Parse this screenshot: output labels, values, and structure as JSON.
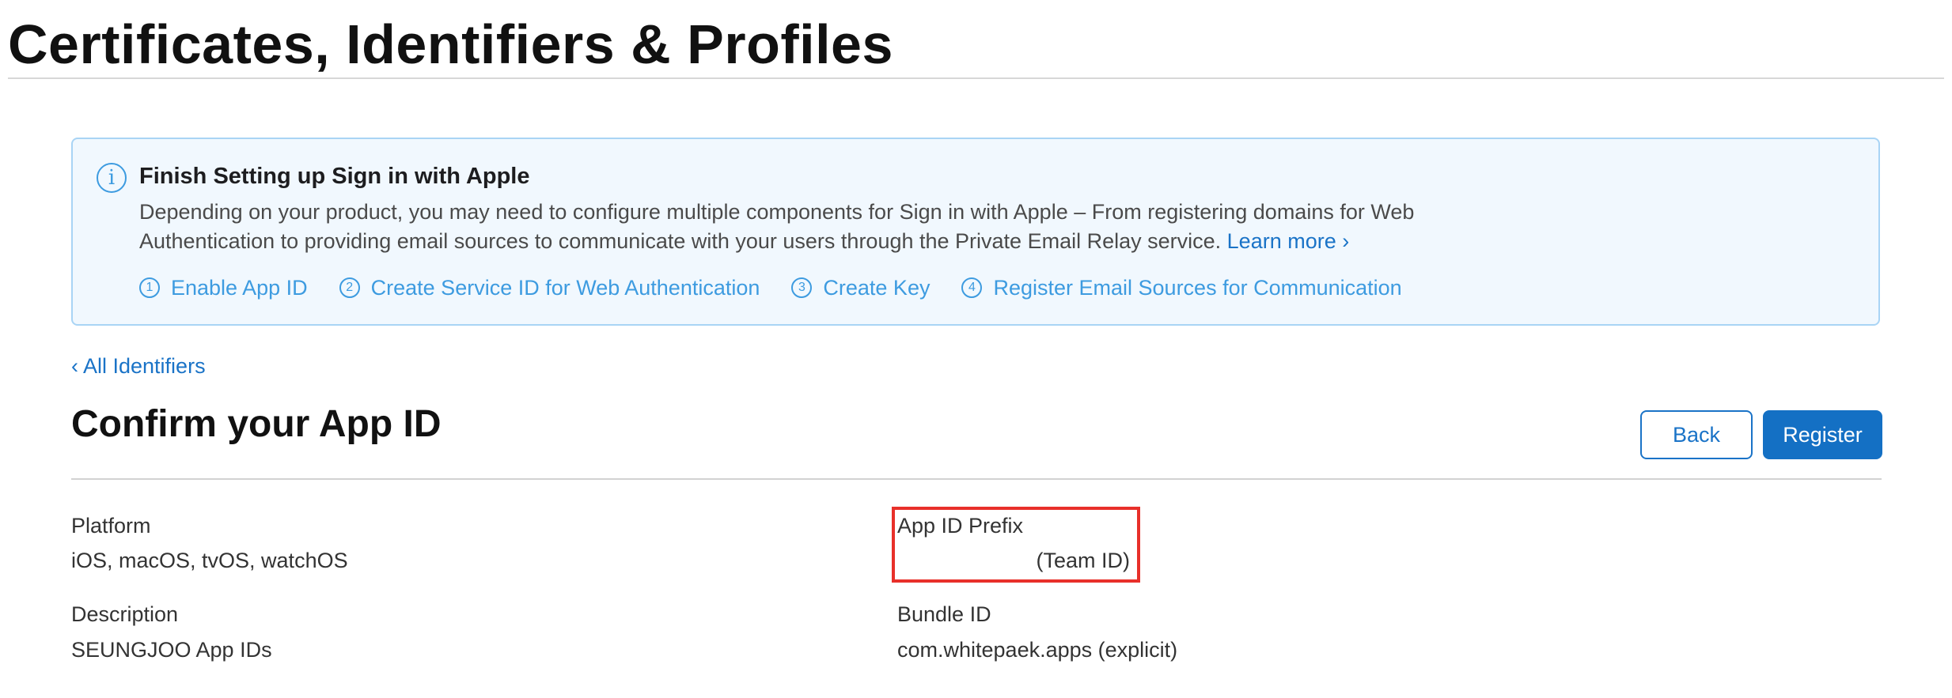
{
  "header": {
    "title": "Certificates, Identifiers & Profiles"
  },
  "banner": {
    "icon": "info-circle-icon",
    "title": "Finish Setting up Sign in with Apple",
    "description": "Depending on your product, you may need to configure multiple components for Sign in with Apple – From registering domains for Web Authentication to providing email sources to communicate with your users through the Private Email Relay service.",
    "learn_more": "Learn more ›",
    "steps": [
      {
        "number": "1",
        "label": "Enable App ID"
      },
      {
        "number": "2",
        "label": "Create Service ID for Web Authentication"
      },
      {
        "number": "3",
        "label": "Create Key"
      },
      {
        "number": "4",
        "label": "Register Email Sources for Communication"
      }
    ],
    "colors": {
      "background": "#f1f8fe",
      "border": "#a9d4f5",
      "link": "#3d9be0"
    }
  },
  "nav": {
    "back_chevron": "‹",
    "back_label": "All Identifiers"
  },
  "section": {
    "title": "Confirm your App ID",
    "back_button": "Back",
    "register_button": "Register"
  },
  "details": {
    "platform": {
      "label": "Platform",
      "value": "iOS, macOS, tvOS, watchOS"
    },
    "app_id_prefix": {
      "label": "App ID Prefix",
      "value": "(Team ID)"
    },
    "description": {
      "label": "Description",
      "value": "SEUNGJOO App IDs"
    },
    "bundle_id": {
      "label": "Bundle ID",
      "value": "com.whitepaek.apps (explicit)"
    }
  },
  "annotation": {
    "highlight_color": "#e8302a"
  }
}
